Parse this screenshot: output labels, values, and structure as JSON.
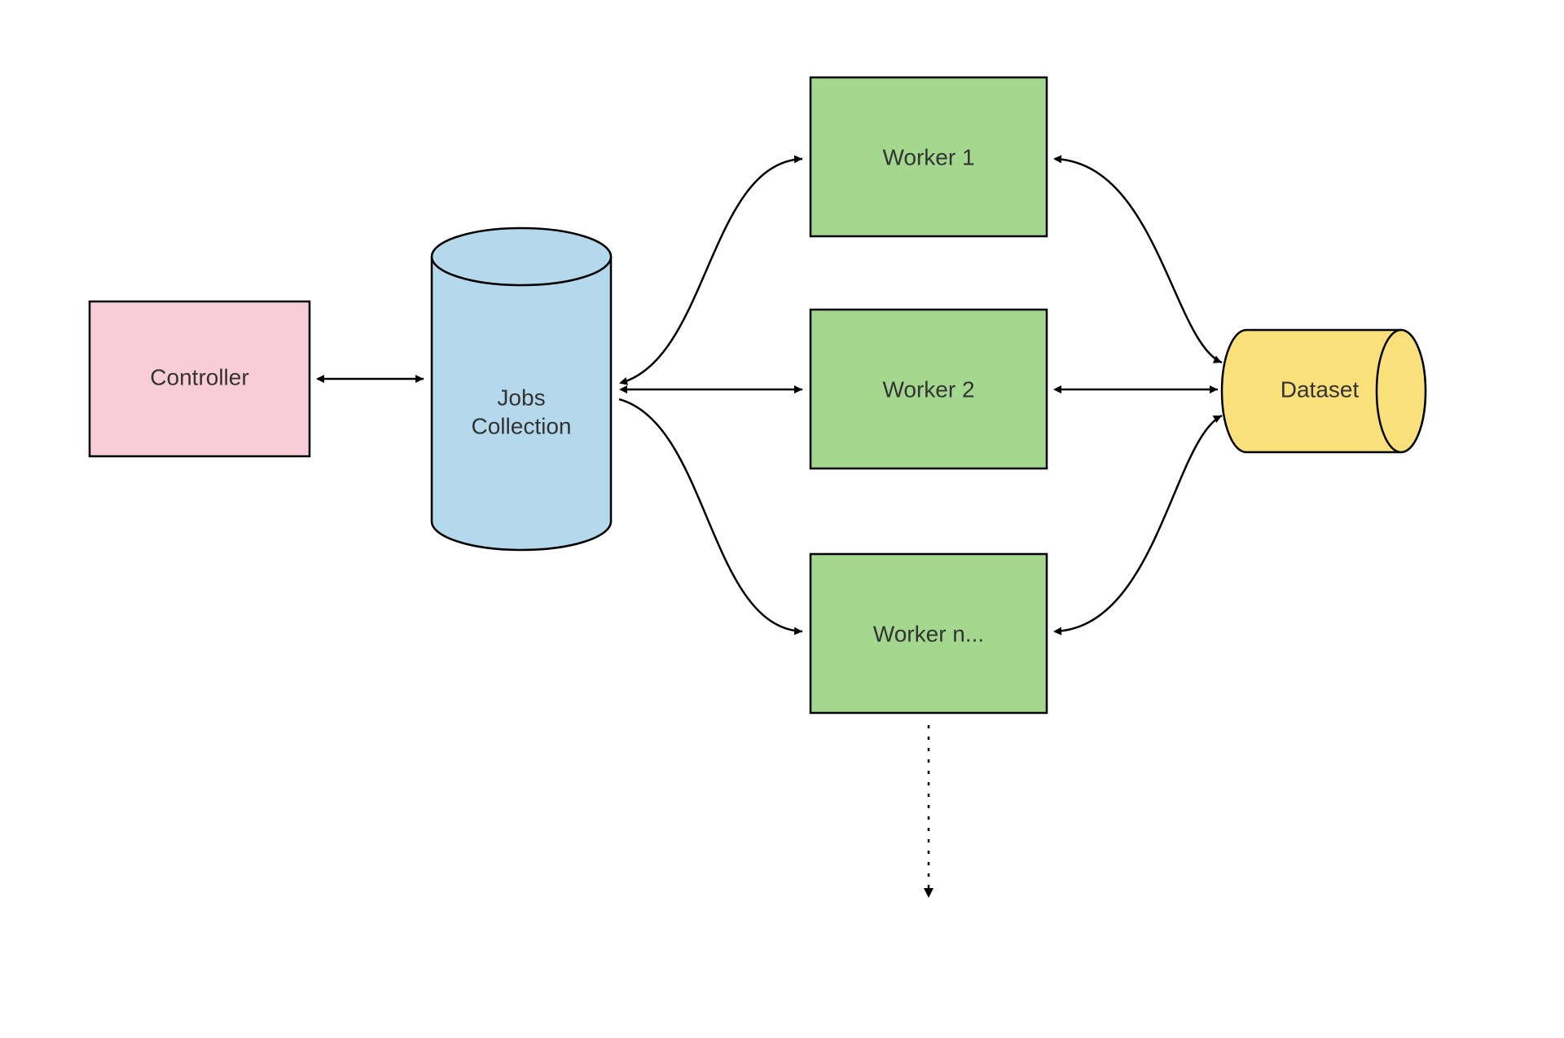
{
  "nodes": {
    "controller": {
      "label": "Controller"
    },
    "jobs": {
      "line1": "Jobs",
      "line2": "Collection"
    },
    "worker1": {
      "label": "Worker 1"
    },
    "worker2": {
      "label": "Worker 2"
    },
    "workern": {
      "label": "Worker n..."
    },
    "dataset": {
      "label": "Dataset"
    }
  },
  "colors": {
    "controller_fill": "#f8cdd9",
    "jobs_fill": "#b4d9ed",
    "worker_fill": "#a4d88f",
    "dataset_fill": "#f9e07a",
    "stroke": "#000000"
  }
}
